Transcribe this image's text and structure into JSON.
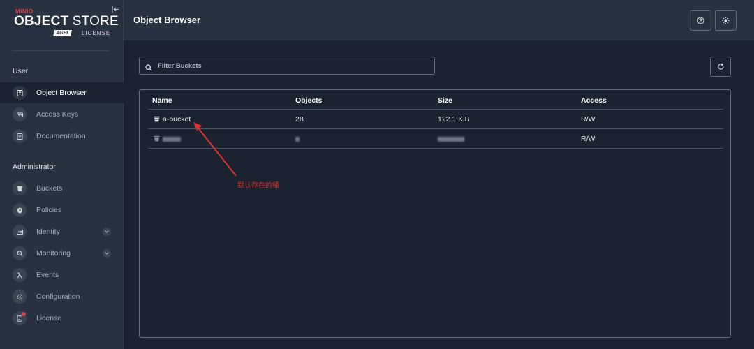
{
  "brand": {
    "minio": "MINIO",
    "object": "OBJECT",
    "store": "STORE",
    "agpl": "AGPL",
    "license": "LICENSE"
  },
  "sidebar": {
    "user_section": "User",
    "admin_section": "Administrator",
    "user_items": [
      {
        "label": "Object Browser",
        "icon": "object-browser-icon"
      },
      {
        "label": "Access Keys",
        "icon": "access-keys-icon"
      },
      {
        "label": "Documentation",
        "icon": "documentation-icon"
      }
    ],
    "admin_items": [
      {
        "label": "Buckets",
        "icon": "buckets-icon"
      },
      {
        "label": "Policies",
        "icon": "policies-icon"
      },
      {
        "label": "Identity",
        "icon": "identity-icon"
      },
      {
        "label": "Monitoring",
        "icon": "monitoring-icon"
      },
      {
        "label": "Events",
        "icon": "events-icon"
      },
      {
        "label": "Configuration",
        "icon": "configuration-icon"
      },
      {
        "label": "License",
        "icon": "license-icon"
      }
    ]
  },
  "header": {
    "title": "Object Browser"
  },
  "filter": {
    "placeholder": "Filter Buckets"
  },
  "table": {
    "columns": [
      "Name",
      "Objects",
      "Size",
      "Access"
    ],
    "rows": [
      {
        "name": "a-bucket",
        "objects": "28",
        "size": "122.1 KiB",
        "access": "R/W"
      },
      {
        "name": "",
        "objects": "",
        "size": "",
        "access": "R/W"
      }
    ]
  },
  "annotation": {
    "text": "默认存在的桶"
  },
  "colors": {
    "accent_red": "#e03030",
    "sidebar_bg": "#28313f",
    "main_bg": "#1b2230"
  }
}
